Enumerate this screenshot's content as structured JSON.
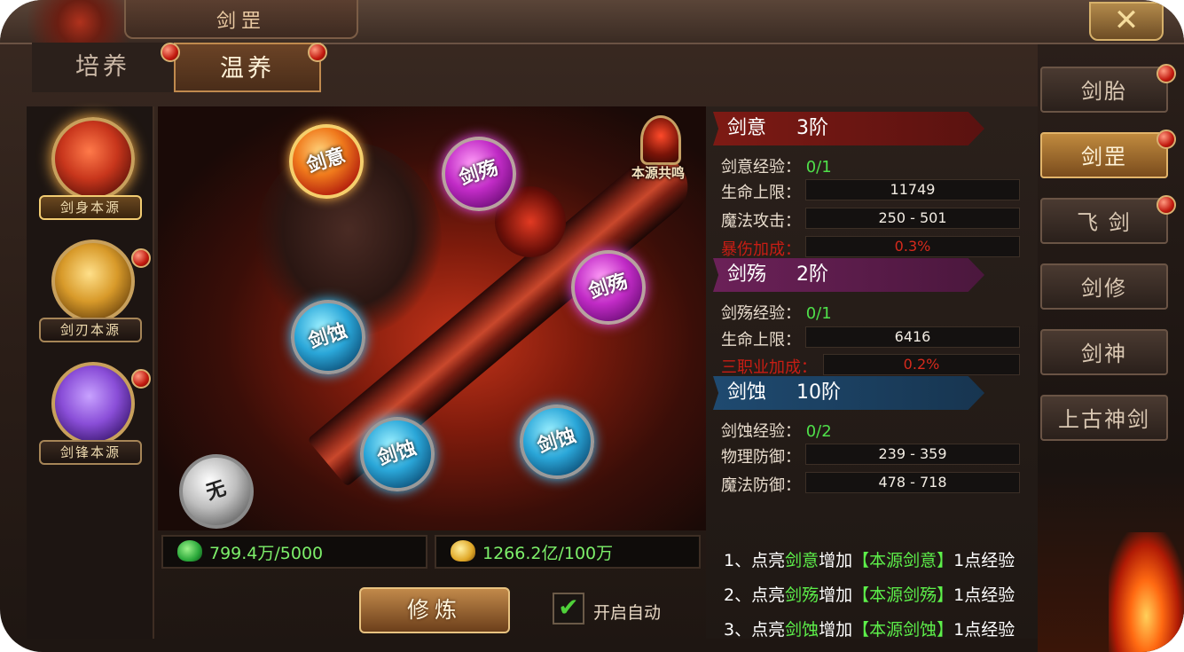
{
  "window": {
    "title": "剑罡",
    "close_icon": "close-x-icon"
  },
  "tabs": [
    {
      "label": "培养",
      "active": false
    },
    {
      "label": "温养",
      "active": true
    }
  ],
  "sources": [
    {
      "label": "剑身本源",
      "active": true,
      "color": "#c8361c",
      "has_dot": false
    },
    {
      "label": "剑刃本源",
      "active": false,
      "color": "#d89a2a",
      "has_dot": true
    },
    {
      "label": "剑锋本源",
      "active": false,
      "color": "#8a4ed8",
      "has_dot": true
    }
  ],
  "scene": {
    "resonance_label": "本源共鸣",
    "orbs": [
      {
        "text": "剑意",
        "type": "gold"
      },
      {
        "text": "剑殇",
        "type": "purple"
      },
      {
        "text": "剑殇",
        "type": "purple"
      },
      {
        "text": "剑蚀",
        "type": "blue"
      },
      {
        "text": "剑蚀",
        "type": "blue"
      },
      {
        "text": "剑蚀",
        "type": "blue"
      },
      {
        "text": "无",
        "type": "white"
      }
    ]
  },
  "resources": [
    {
      "text": "799.4万/5000",
      "icon": "jade-icon"
    },
    {
      "text": "1266.2亿/100万",
      "icon": "gold-ingot-icon"
    }
  ],
  "controls": {
    "cultivate_label": "修炼",
    "auto_label": "开启自动",
    "auto_checked": true
  },
  "stats": {
    "jianyi": {
      "name": "剑意",
      "level": "3阶",
      "exp_label": "剑意经验：",
      "exp_value": "0/1",
      "rows": [
        {
          "label": "生命上限：",
          "value": "11749",
          "red": false
        },
        {
          "label": "魔法攻击：",
          "value": "250 - 501",
          "red": false
        },
        {
          "label": "暴伤加成：",
          "value": "0.3%",
          "red": true
        }
      ]
    },
    "jianshang": {
      "name": "剑殇",
      "level": "2阶",
      "exp_label": "剑殇经验：",
      "exp_value": "0/1",
      "rows": [
        {
          "label": "生命上限：",
          "value": "6416",
          "red": false
        },
        {
          "label": "三职业加成：",
          "value": "0.2%",
          "red": true
        }
      ]
    },
    "jianshi": {
      "name": "剑蚀",
      "level": "10阶",
      "exp_label": "剑蚀经验：",
      "exp_value": "0/2",
      "rows": [
        {
          "label": "物理防御：",
          "value": "239 - 359",
          "red": false
        },
        {
          "label": "魔法防御：",
          "value": "478 - 718",
          "red": false
        }
      ]
    }
  },
  "instructions": [
    {
      "prefix": "1、点亮",
      "hl": "剑意",
      "mid": "增加",
      "bracket": "【本源剑意】",
      "suffix": "1点经验"
    },
    {
      "prefix": "2、点亮",
      "hl": "剑殇",
      "mid": "增加",
      "bracket": "【本源剑殇】",
      "suffix": "1点经验"
    },
    {
      "prefix": "3、点亮",
      "hl": "剑蚀",
      "mid": "增加",
      "bracket": "【本源剑蚀】",
      "suffix": "1点经验"
    }
  ],
  "nav": [
    {
      "label": "剑胎",
      "active": false,
      "has_dot": true
    },
    {
      "label": "剑罡",
      "active": true,
      "has_dot": true
    },
    {
      "label": "飞 剑",
      "active": false,
      "has_dot": true
    },
    {
      "label": "剑修",
      "active": false,
      "has_dot": false
    },
    {
      "label": "剑神",
      "active": false,
      "has_dot": false
    },
    {
      "label": "上古神剑",
      "active": false,
      "has_dot": false
    }
  ],
  "colors": {
    "accent_gold": "#c08a4e",
    "exp_green": "#4fe04a",
    "warn_red": "#c81d14",
    "notify_red": "#c21a0f"
  }
}
